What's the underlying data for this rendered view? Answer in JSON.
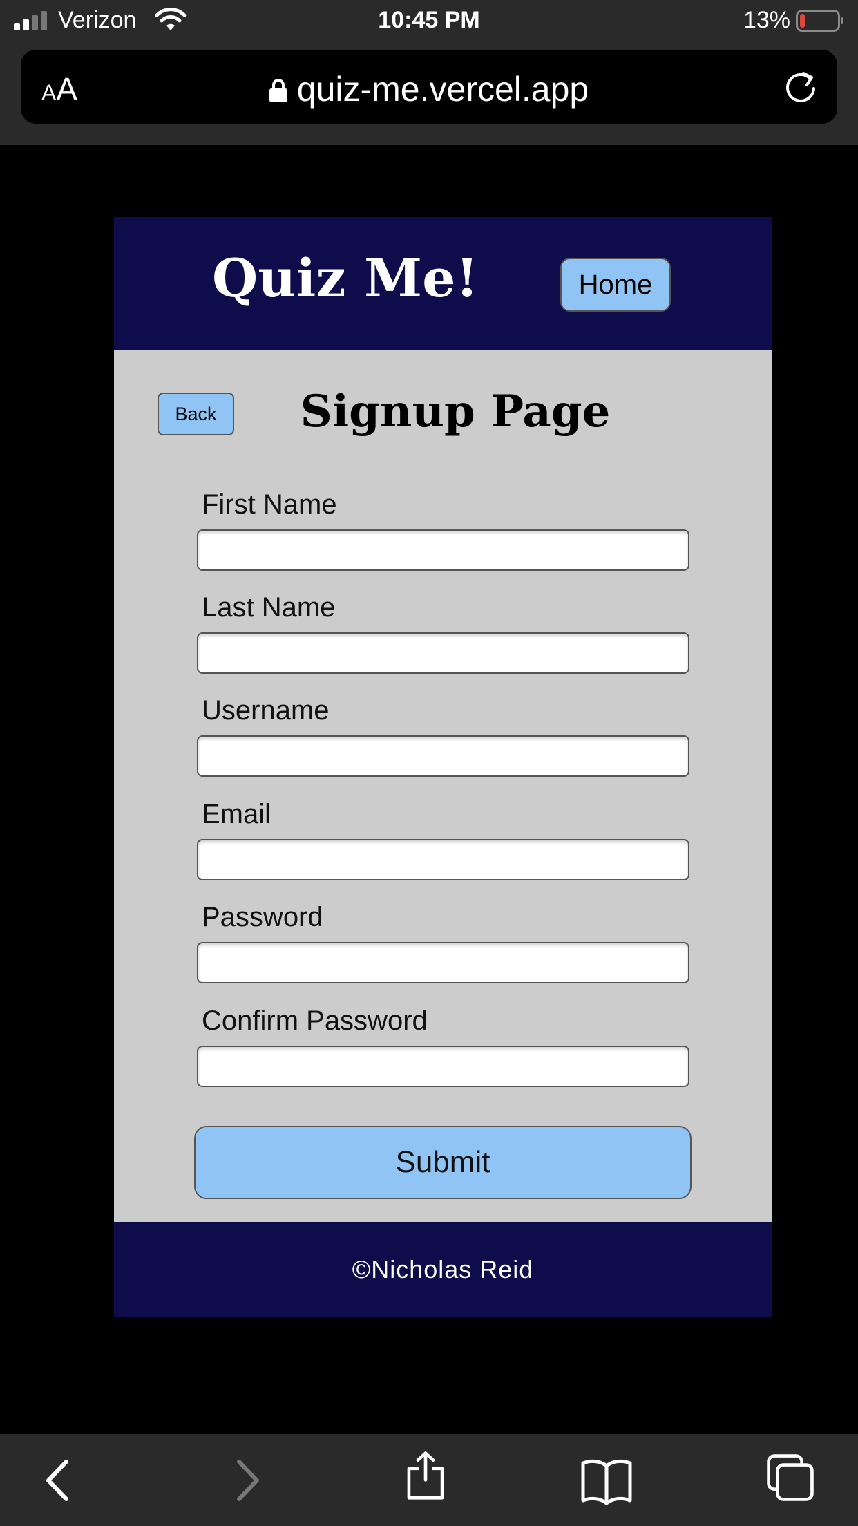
{
  "status_bar": {
    "carrier": "Verizon",
    "time": "10:45 PM",
    "battery_percent": "13%",
    "battery_level": 0.13
  },
  "browser": {
    "text_size_label_small": "A",
    "text_size_label_large": "A",
    "url": "quiz-me.vercel.app"
  },
  "header": {
    "title": "Quiz Me!",
    "home_label": "Home"
  },
  "signup": {
    "back_label": "Back",
    "title": "Signup Page",
    "fields": [
      {
        "label": "First Name",
        "value": ""
      },
      {
        "label": "Last Name",
        "value": ""
      },
      {
        "label": "Username",
        "value": ""
      },
      {
        "label": "Email",
        "value": ""
      },
      {
        "label": "Password",
        "value": ""
      },
      {
        "label": "Confirm Password",
        "value": ""
      }
    ],
    "submit_label": "Submit"
  },
  "footer": {
    "text": "©Nicholas Reid"
  },
  "colors": {
    "header_bg": "#0e0c4a",
    "button_bg": "#90c4f4",
    "content_bg": "#cccccc"
  },
  "toolbar": {
    "icons": [
      "back-arrow-icon",
      "forward-arrow-icon",
      "share-icon",
      "bookmarks-icon",
      "tabs-icon"
    ]
  }
}
